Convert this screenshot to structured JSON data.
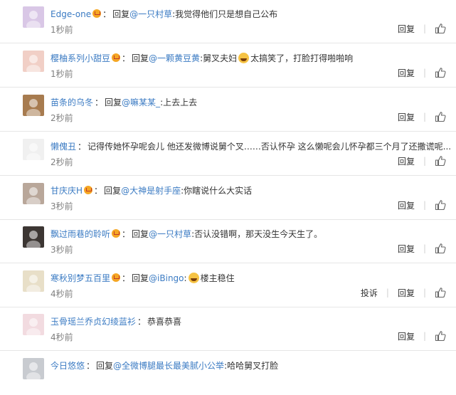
{
  "reply_keyword": "回复",
  "report_label": "投诉",
  "reply_label": "回复",
  "like_icon": "thumbs-up-icon",
  "comments": [
    {
      "username": "Edge-one",
      "vip": true,
      "mention": "@一只村草",
      "text": ":我觉得他们只是想自己公布",
      "time": "1秒前",
      "avatar_color": "#d9c7e6"
    },
    {
      "username": "樱柚系列小甜豆",
      "vip": true,
      "mention": "@一颗黄豆黄",
      "text": ":舅叉夫妇",
      "emoji": true,
      "text_after_emoji": "太搞笑了，打脸打得啪啪响",
      "time": "1秒前",
      "avatar_color": "#f1cfc6"
    },
    {
      "username": "苗条的乌冬",
      "vip": false,
      "mention": "@嘛某某_",
      "text": ":上去上去",
      "time": "2秒前",
      "avatar_color": "#a77b4f"
    },
    {
      "username": "懒傀丑",
      "vip": false,
      "mention": "",
      "text": "记得传她怀孕呢会儿 他还发微博说舅个叉……否认怀孕 这么懒呢会儿怀孕都三个月了还撒谎呢...",
      "time": "2秒前",
      "avatar_color": "#f0f0f0"
    },
    {
      "username": "甘庆庆H",
      "vip": true,
      "mention": "@大神是射手座",
      "text": ":你瞎说什么大实话",
      "time": "3秒前",
      "avatar_color": "#b9a79a"
    },
    {
      "username": "飘过雨巷的聆听",
      "vip": true,
      "mention": "@一只村草",
      "text": ":否认没错啊，那天没生今天生了。",
      "time": "3秒前",
      "avatar_color": "#3c3633"
    },
    {
      "username": "寒秋别梦五百里",
      "vip": true,
      "mention": "@iBingo",
      "text": ":",
      "emoji": true,
      "text_after_emoji": "楼主稳住",
      "time": "4秒前",
      "avatar_color": "#e8dfc8",
      "show_report": true
    },
    {
      "username": "玉骨瑶兰乔贞幻绫蓝衫",
      "vip": false,
      "mention": "",
      "text": "恭喜恭喜",
      "time": "4秒前",
      "avatar_color": "#f2dbe0"
    },
    {
      "username": "今日悠悠",
      "vip": false,
      "mention": "@全微博腿最长最美腻小公举",
      "text": ":哈哈舅叉打脸",
      "time": "",
      "avatar_color": "#c8cbd0"
    }
  ]
}
